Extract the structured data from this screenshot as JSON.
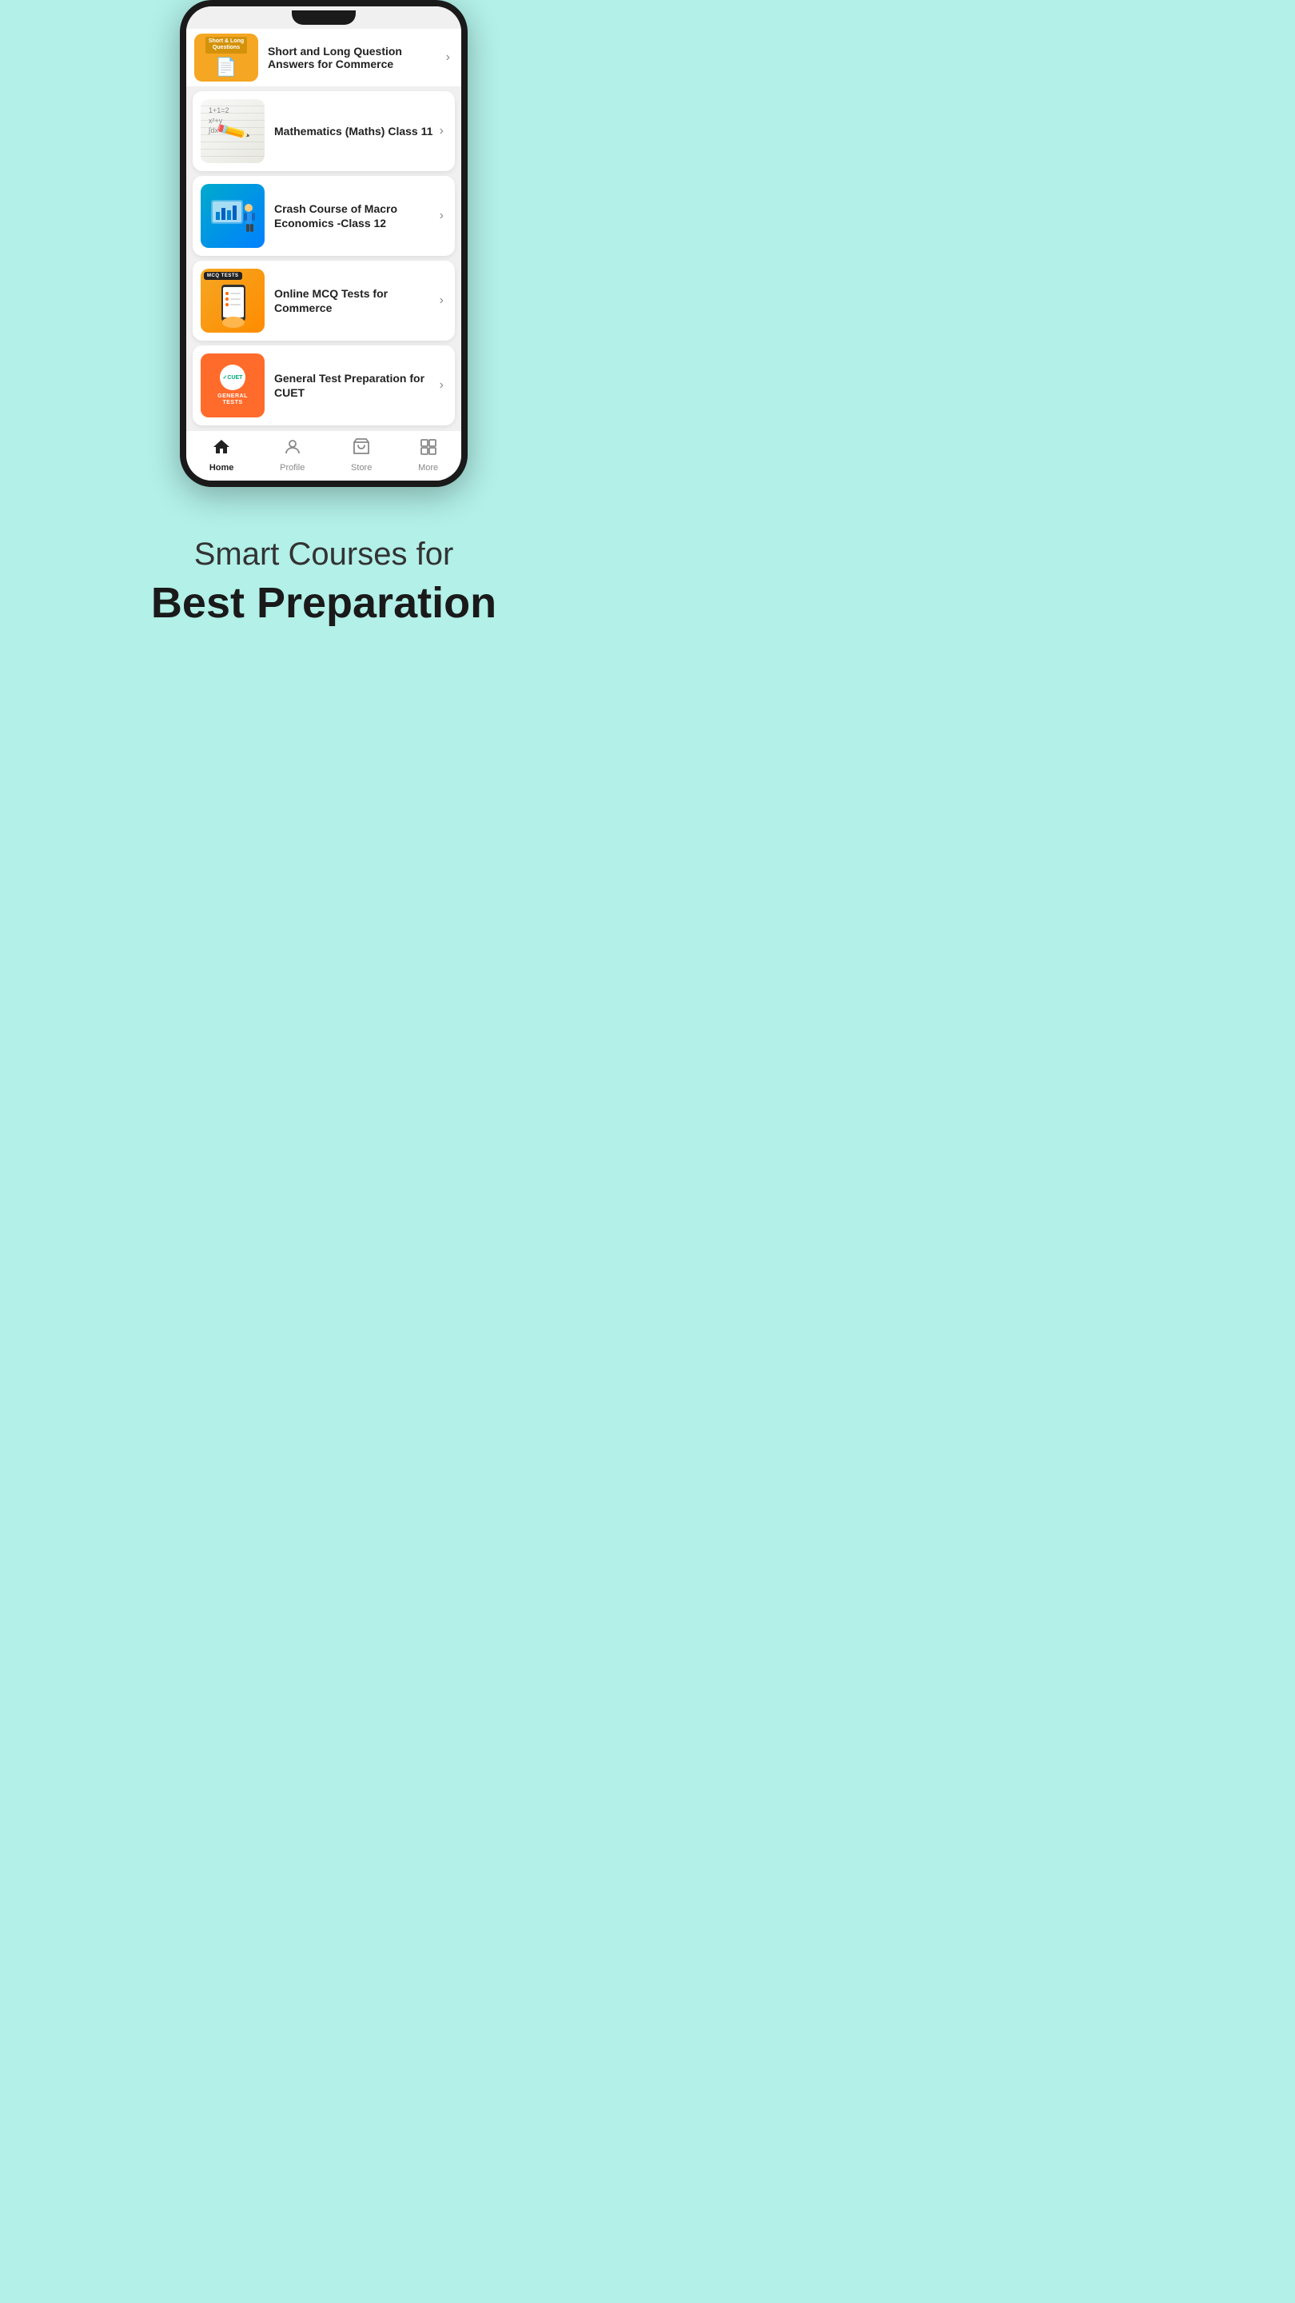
{
  "phone": {
    "items": [
      {
        "id": "short-long",
        "title": "Short and Long Question Answers for Commerce",
        "badge_line1": "Short & Long",
        "badge_line2": "Questions",
        "type": "partial"
      },
      {
        "id": "maths",
        "title": "Mathematics (Maths) Class 11",
        "type": "math"
      },
      {
        "id": "macro-econ",
        "title": "Crash Course of Macro Economics -Class 12",
        "type": "econ"
      },
      {
        "id": "mcq",
        "title": "Online MCQ Tests for Commerce",
        "type": "mcq",
        "badge": "MCQ TESTS"
      },
      {
        "id": "cuet",
        "title": "General Test Preparation for CUET",
        "type": "cuet",
        "badge_line1": "GENERAL",
        "badge_line2": "TESTS"
      }
    ],
    "nav": {
      "items": [
        {
          "id": "home",
          "label": "Home",
          "icon": "home",
          "active": true
        },
        {
          "id": "profile",
          "label": "Profile",
          "icon": "person",
          "active": false
        },
        {
          "id": "store",
          "label": "Store",
          "icon": "cart",
          "active": false
        },
        {
          "id": "more",
          "label": "More",
          "icon": "grid",
          "active": false
        }
      ]
    }
  },
  "bottom": {
    "line1": "Smart Courses for",
    "line2": "Best Preparation"
  }
}
